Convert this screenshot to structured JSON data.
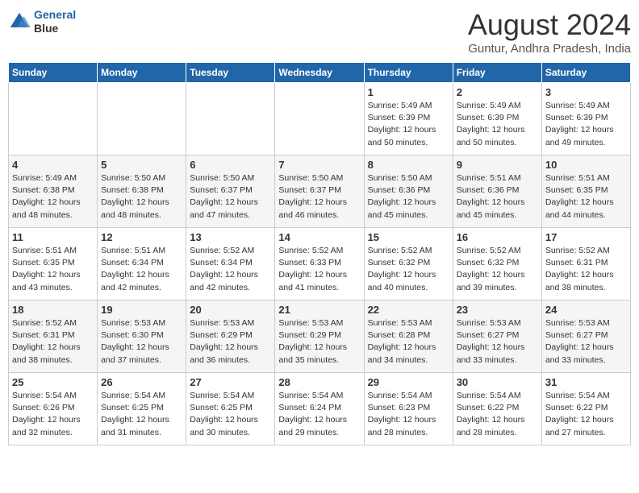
{
  "header": {
    "logo_line1": "General",
    "logo_line2": "Blue",
    "month": "August 2024",
    "location": "Guntur, Andhra Pradesh, India"
  },
  "weekdays": [
    "Sunday",
    "Monday",
    "Tuesday",
    "Wednesday",
    "Thursday",
    "Friday",
    "Saturday"
  ],
  "weeks": [
    [
      {
        "day": "",
        "detail": ""
      },
      {
        "day": "",
        "detail": ""
      },
      {
        "day": "",
        "detail": ""
      },
      {
        "day": "",
        "detail": ""
      },
      {
        "day": "1",
        "detail": "Sunrise: 5:49 AM\nSunset: 6:39 PM\nDaylight: 12 hours\nand 50 minutes."
      },
      {
        "day": "2",
        "detail": "Sunrise: 5:49 AM\nSunset: 6:39 PM\nDaylight: 12 hours\nand 50 minutes."
      },
      {
        "day": "3",
        "detail": "Sunrise: 5:49 AM\nSunset: 6:39 PM\nDaylight: 12 hours\nand 49 minutes."
      }
    ],
    [
      {
        "day": "4",
        "detail": "Sunrise: 5:49 AM\nSunset: 6:38 PM\nDaylight: 12 hours\nand 48 minutes."
      },
      {
        "day": "5",
        "detail": "Sunrise: 5:50 AM\nSunset: 6:38 PM\nDaylight: 12 hours\nand 48 minutes."
      },
      {
        "day": "6",
        "detail": "Sunrise: 5:50 AM\nSunset: 6:37 PM\nDaylight: 12 hours\nand 47 minutes."
      },
      {
        "day": "7",
        "detail": "Sunrise: 5:50 AM\nSunset: 6:37 PM\nDaylight: 12 hours\nand 46 minutes."
      },
      {
        "day": "8",
        "detail": "Sunrise: 5:50 AM\nSunset: 6:36 PM\nDaylight: 12 hours\nand 45 minutes."
      },
      {
        "day": "9",
        "detail": "Sunrise: 5:51 AM\nSunset: 6:36 PM\nDaylight: 12 hours\nand 45 minutes."
      },
      {
        "day": "10",
        "detail": "Sunrise: 5:51 AM\nSunset: 6:35 PM\nDaylight: 12 hours\nand 44 minutes."
      }
    ],
    [
      {
        "day": "11",
        "detail": "Sunrise: 5:51 AM\nSunset: 6:35 PM\nDaylight: 12 hours\nand 43 minutes."
      },
      {
        "day": "12",
        "detail": "Sunrise: 5:51 AM\nSunset: 6:34 PM\nDaylight: 12 hours\nand 42 minutes."
      },
      {
        "day": "13",
        "detail": "Sunrise: 5:52 AM\nSunset: 6:34 PM\nDaylight: 12 hours\nand 42 minutes."
      },
      {
        "day": "14",
        "detail": "Sunrise: 5:52 AM\nSunset: 6:33 PM\nDaylight: 12 hours\nand 41 minutes."
      },
      {
        "day": "15",
        "detail": "Sunrise: 5:52 AM\nSunset: 6:32 PM\nDaylight: 12 hours\nand 40 minutes."
      },
      {
        "day": "16",
        "detail": "Sunrise: 5:52 AM\nSunset: 6:32 PM\nDaylight: 12 hours\nand 39 minutes."
      },
      {
        "day": "17",
        "detail": "Sunrise: 5:52 AM\nSunset: 6:31 PM\nDaylight: 12 hours\nand 38 minutes."
      }
    ],
    [
      {
        "day": "18",
        "detail": "Sunrise: 5:52 AM\nSunset: 6:31 PM\nDaylight: 12 hours\nand 38 minutes."
      },
      {
        "day": "19",
        "detail": "Sunrise: 5:53 AM\nSunset: 6:30 PM\nDaylight: 12 hours\nand 37 minutes."
      },
      {
        "day": "20",
        "detail": "Sunrise: 5:53 AM\nSunset: 6:29 PM\nDaylight: 12 hours\nand 36 minutes."
      },
      {
        "day": "21",
        "detail": "Sunrise: 5:53 AM\nSunset: 6:29 PM\nDaylight: 12 hours\nand 35 minutes."
      },
      {
        "day": "22",
        "detail": "Sunrise: 5:53 AM\nSunset: 6:28 PM\nDaylight: 12 hours\nand 34 minutes."
      },
      {
        "day": "23",
        "detail": "Sunrise: 5:53 AM\nSunset: 6:27 PM\nDaylight: 12 hours\nand 33 minutes."
      },
      {
        "day": "24",
        "detail": "Sunrise: 5:53 AM\nSunset: 6:27 PM\nDaylight: 12 hours\nand 33 minutes."
      }
    ],
    [
      {
        "day": "25",
        "detail": "Sunrise: 5:54 AM\nSunset: 6:26 PM\nDaylight: 12 hours\nand 32 minutes."
      },
      {
        "day": "26",
        "detail": "Sunrise: 5:54 AM\nSunset: 6:25 PM\nDaylight: 12 hours\nand 31 minutes."
      },
      {
        "day": "27",
        "detail": "Sunrise: 5:54 AM\nSunset: 6:25 PM\nDaylight: 12 hours\nand 30 minutes."
      },
      {
        "day": "28",
        "detail": "Sunrise: 5:54 AM\nSunset: 6:24 PM\nDaylight: 12 hours\nand 29 minutes."
      },
      {
        "day": "29",
        "detail": "Sunrise: 5:54 AM\nSunset: 6:23 PM\nDaylight: 12 hours\nand 28 minutes."
      },
      {
        "day": "30",
        "detail": "Sunrise: 5:54 AM\nSunset: 6:22 PM\nDaylight: 12 hours\nand 28 minutes."
      },
      {
        "day": "31",
        "detail": "Sunrise: 5:54 AM\nSunset: 6:22 PM\nDaylight: 12 hours\nand 27 minutes."
      }
    ]
  ]
}
